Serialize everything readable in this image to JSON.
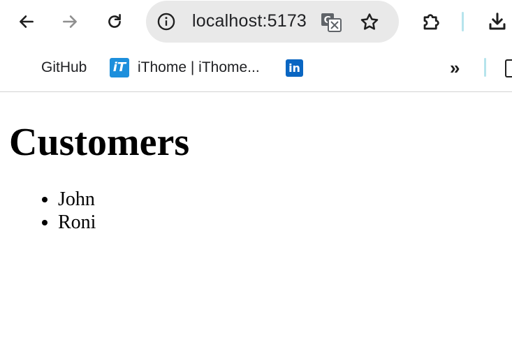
{
  "browser": {
    "url": "localhost:5173",
    "icons": {
      "back": "arrow-left-icon",
      "forward": "arrow-right-icon",
      "reload": "reload-icon",
      "site_info": "info-icon",
      "translate": "translate-icon",
      "bookmark_star": "star-icon",
      "extensions": "puzzle-icon",
      "downloads": "download-icon"
    },
    "colors": {
      "omnibox_bg": "#e9e9e9",
      "divider": "#b6e4ec",
      "linkedin": "#0a66c2",
      "ithome": "#1d8fdc"
    }
  },
  "bookmarks_bar": {
    "items": [
      {
        "label": "GitHub"
      },
      {
        "label": "iThome | iThome...",
        "icon_text": "iT"
      },
      {
        "label": "",
        "icon_text": "in"
      }
    ],
    "overflow_label": "»"
  },
  "page": {
    "heading": "Customers",
    "customers": [
      "John",
      "Roni"
    ]
  }
}
